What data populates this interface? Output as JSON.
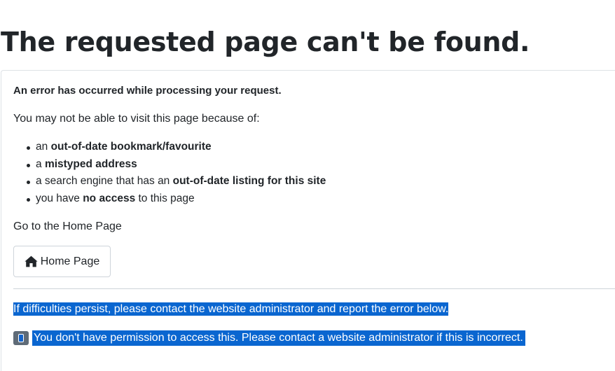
{
  "page": {
    "title": "The requested page can't be found."
  },
  "error": {
    "heading": "An error has occurred while processing your request.",
    "reasons_intro": "You may not be able to visit this page because of:",
    "reasons": [
      {
        "before": "an ",
        "bold": "out-of-date bookmark/favourite",
        "after": ""
      },
      {
        "before": "a ",
        "bold": "mistyped address",
        "after": ""
      },
      {
        "before": "a search engine that has an ",
        "bold": "out-of-date listing for this site",
        "after": ""
      },
      {
        "before": "you have ",
        "bold": "no access",
        "after": " to this page"
      }
    ],
    "goto_text": "Go to the Home Page",
    "home_button_label": "Home Page",
    "persist_message": "If difficulties persist, please contact the website administrator and report the error below.",
    "permission_message": "You don't have permission to access this. Please contact a website administrator if this is incorrect."
  },
  "icons": {
    "home": "home-icon",
    "info": "info-icon"
  },
  "colors": {
    "text": "#212529",
    "border": "#dee2e6",
    "selection": "#0a66d0",
    "badge": "#5f6b77"
  }
}
